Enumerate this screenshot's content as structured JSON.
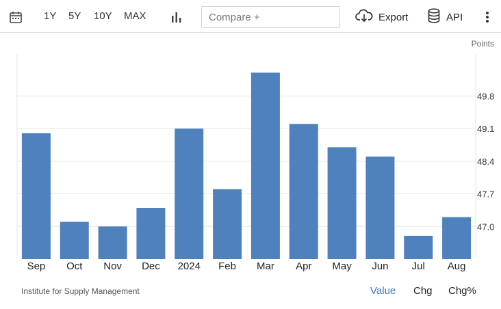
{
  "toolbar": {
    "range_buttons": [
      "1Y",
      "5Y",
      "10Y",
      "MAX"
    ],
    "compare_placeholder": "Compare +",
    "export_label": "Export",
    "api_label": "API"
  },
  "icons": {
    "calendar": "calendar-icon",
    "chart_type": "bar-chart-icon",
    "export": "cloud-download-icon",
    "api": "database-icon",
    "more": "vertical-dots-icon"
  },
  "units": "Points",
  "source": "Institute for Supply Management",
  "view_tabs": {
    "value": "Value",
    "chg": "Chg",
    "chgp": "Chg%"
  },
  "colors": {
    "bar": "#4f81bd",
    "active_tab": "#3a7cc9",
    "grid": "#e6e6e6"
  },
  "chart_data": {
    "type": "bar",
    "categories": [
      "Sep",
      "Oct",
      "Nov",
      "Dec",
      "2024",
      "Feb",
      "Mar",
      "Apr",
      "May",
      "Jun",
      "Jul",
      "Aug"
    ],
    "values": [
      49.0,
      47.1,
      47.0,
      47.4,
      49.1,
      47.8,
      50.3,
      49.2,
      48.7,
      48.5,
      46.8,
      47.2
    ],
    "yticks": [
      47.0,
      47.7,
      48.4,
      49.1,
      49.8
    ],
    "ylim": [
      46.3,
      50.7
    ],
    "grid": true,
    "title": "",
    "xlabel": "",
    "ylabel": "Points"
  }
}
